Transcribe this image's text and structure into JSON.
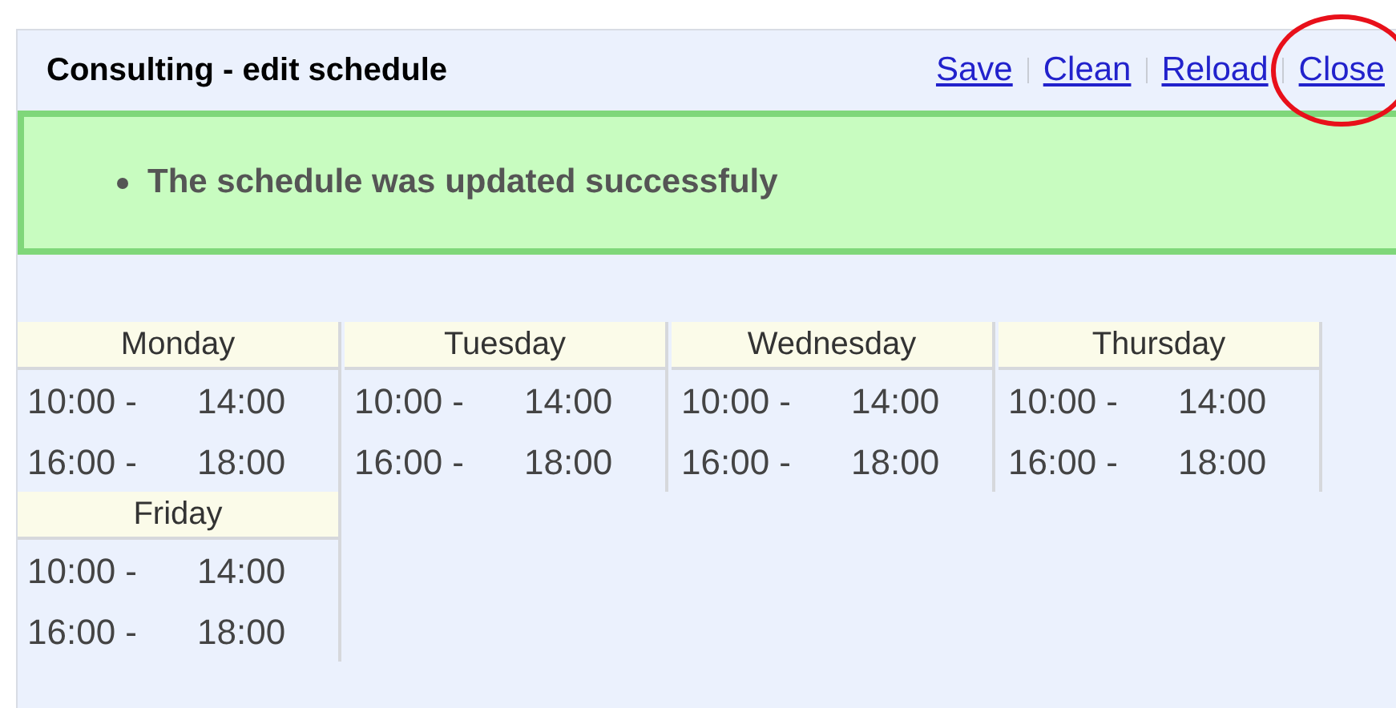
{
  "panel": {
    "title": "Consulting - edit schedule"
  },
  "links": [
    {
      "label": "Save",
      "circled": false
    },
    {
      "label": "Clean",
      "circled": false
    },
    {
      "label": "Reload",
      "circled": false
    },
    {
      "label": "Close",
      "circled": true
    }
  ],
  "messages": [
    "The schedule was updated successfuly"
  ],
  "days": [
    {
      "name": "Monday",
      "slots": [
        [
          "10:00 -",
          "14:00"
        ],
        [
          "16:00 -",
          "18:00"
        ]
      ]
    },
    {
      "name": "Tuesday",
      "slots": [
        [
          "10:00 -",
          "14:00"
        ],
        [
          "16:00 -",
          "18:00"
        ]
      ]
    },
    {
      "name": "Wednesday",
      "slots": [
        [
          "10:00 -",
          "14:00"
        ],
        [
          "16:00 -",
          "18:00"
        ]
      ]
    },
    {
      "name": "Thursday",
      "slots": [
        [
          "10:00 -",
          "14:00"
        ],
        [
          "16:00 -",
          "18:00"
        ]
      ]
    },
    {
      "name": "Friday",
      "slots": [
        [
          "10:00 -",
          "14:00"
        ],
        [
          "16:00 -",
          "18:00"
        ]
      ]
    }
  ]
}
